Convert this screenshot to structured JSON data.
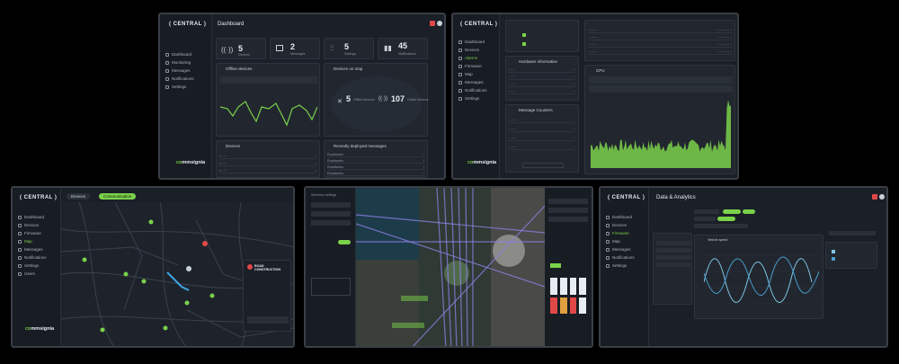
{
  "panel1": {
    "logo": "( CENTRAL )",
    "title": "Dashboard",
    "nav": [
      "Dashboard",
      "Monitoring",
      "Messages",
      "Notifications",
      "Settings"
    ],
    "stats": [
      {
        "value": "5",
        "label": "Devices"
      },
      {
        "value": "2",
        "label": "Messages"
      },
      {
        "value": "5",
        "label": "Settings"
      },
      {
        "value": "45",
        "label": "Notifications"
      }
    ],
    "offline_title": "Offline devices",
    "map_title": "Devices on map",
    "map_offline": "5",
    "map_offline_label": "Offline devices",
    "map_online": "107",
    "map_online_label": "Online devices",
    "devices_title": "Devices",
    "recent_title": "Recently deployed messages",
    "recent_items": [
      "Roadworks",
      "Roadworks",
      "Roadworks",
      "Roadworks"
    ],
    "brand_a": "co",
    "brand_b": "mmsignia"
  },
  "panel2": {
    "logo": "( CENTRAL )",
    "nav": [
      "Dashboard",
      "Devices",
      "Alarms",
      "Firmware",
      "Map",
      "Messages",
      "Notifications",
      "Settings"
    ],
    "hw_title": "Hardware information",
    "msg_title": "Message Counters",
    "cpu_title": "CPU",
    "brand_a": "co",
    "brand_b": "mmsignia"
  },
  "panel3": {
    "logo": "( CENTRAL )",
    "tab_devices": "Devices",
    "tab_other": "Communication",
    "nav": [
      "Dashboard",
      "Devices",
      "Firmware",
      "Map",
      "Messages",
      "Notifications",
      "Settings",
      "Users"
    ],
    "popup_title": "ROAD CONSTRUCTION",
    "brand_a": "co",
    "brand_b": "mmsignia"
  },
  "panel4": {
    "sidebar_label": "Selection settings"
  },
  "panel5": {
    "logo": "( CENTRAL )",
    "title": "Data & Analytics",
    "nav": [
      "Dashboard",
      "Devices",
      "Firmware",
      "Map",
      "Messages",
      "Notifications",
      "Settings"
    ],
    "chart_title": "Vehicle speed"
  }
}
